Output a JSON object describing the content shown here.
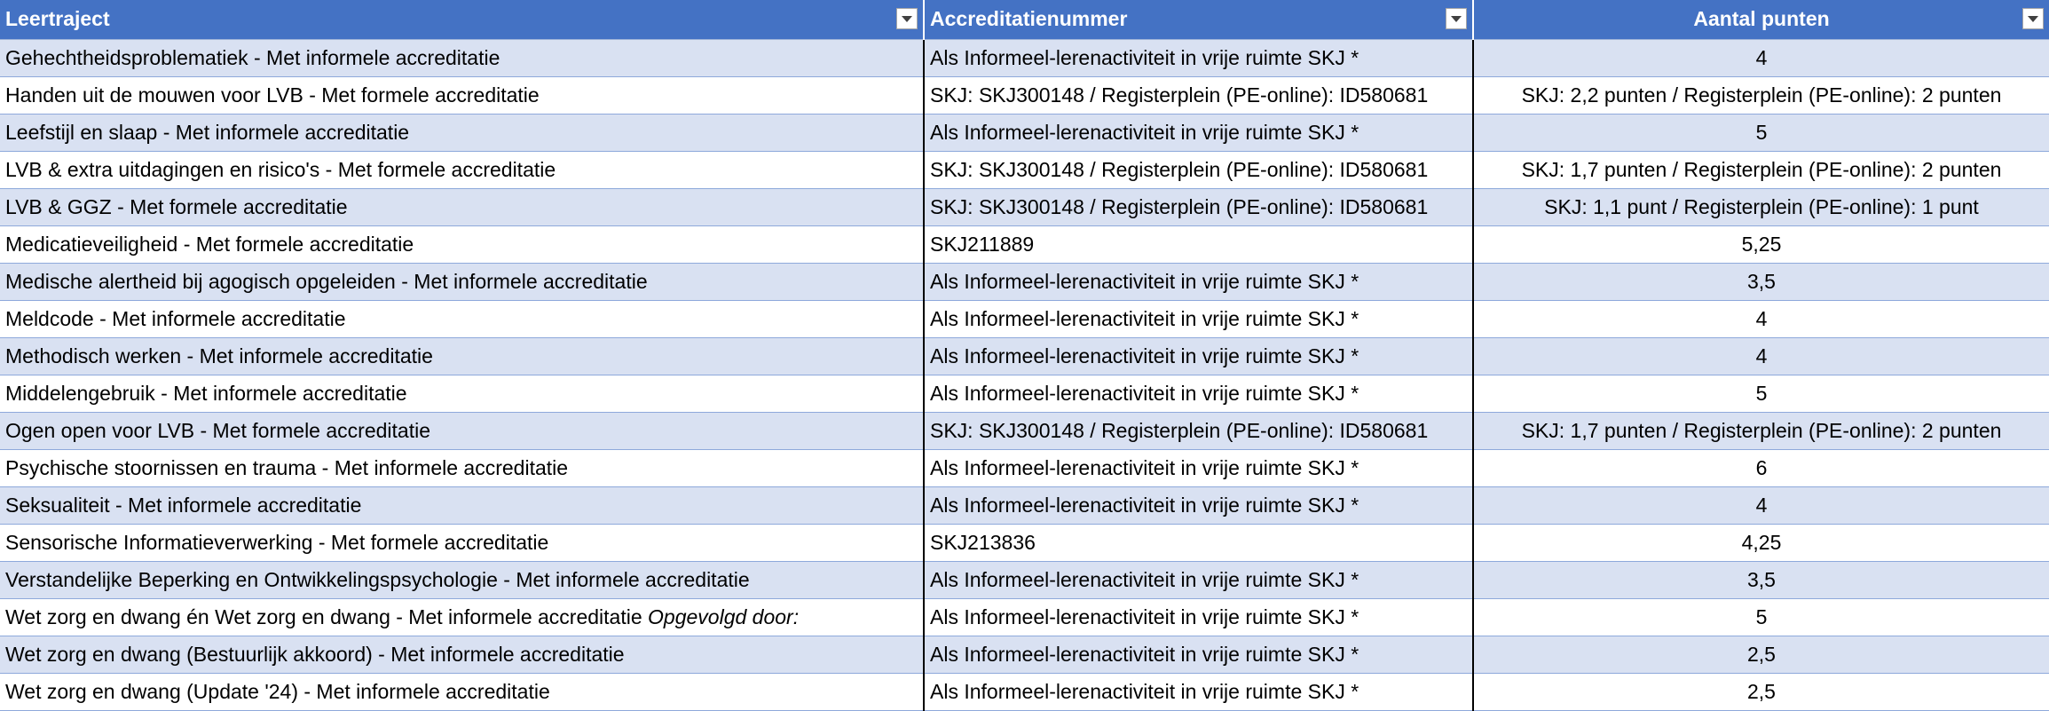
{
  "table": {
    "headers": [
      "Leertraject",
      "Accreditatienummer",
      "Aantal punten"
    ],
    "rows": [
      {
        "leertraject": "Gehechtheidsproblematiek - Met informele accreditatie",
        "accreditatienummer": "Als Informeel-lerenactiviteit in vrije ruimte SKJ *",
        "punten": "4"
      },
      {
        "leertraject": "Handen uit de mouwen voor LVB - Met formele accreditatie",
        "accreditatienummer": "SKJ: SKJ300148 / Registerplein (PE-online): ID580681",
        "punten": "SKJ: 2,2 punten / Registerplein (PE-online): 2 punten"
      },
      {
        "leertraject": "Leefstijl en slaap - Met informele accreditatie",
        "accreditatienummer": "Als Informeel-lerenactiviteit in vrije ruimte SKJ *",
        "punten": "5"
      },
      {
        "leertraject": "LVB & extra uitdagingen en risico's - Met formele accreditatie",
        "accreditatienummer": "SKJ: SKJ300148 / Registerplein (PE-online): ID580681",
        "punten": "SKJ: 1,7 punten / Registerplein (PE-online): 2 punten"
      },
      {
        "leertraject": "LVB & GGZ - Met formele accreditatie",
        "accreditatienummer": "SKJ: SKJ300148 / Registerplein (PE-online): ID580681",
        "punten": "SKJ: 1,1 punt / Registerplein (PE-online): 1 punt"
      },
      {
        "leertraject": "Medicatieveiligheid - Met formele accreditatie",
        "accreditatienummer": "SKJ211889",
        "punten": "5,25"
      },
      {
        "leertraject": "Medische alertheid bij agogisch opgeleiden - Met informele accreditatie",
        "accreditatienummer": "Als Informeel-lerenactiviteit in vrije ruimte SKJ *",
        "punten": "3,5"
      },
      {
        "leertraject": "Meldcode - Met informele accreditatie",
        "accreditatienummer": "Als Informeel-lerenactiviteit in vrije ruimte SKJ *",
        "punten": "4"
      },
      {
        "leertraject": "Methodisch werken - Met informele accreditatie",
        "accreditatienummer": "Als Informeel-lerenactiviteit in vrije ruimte SKJ *",
        "punten": "4"
      },
      {
        "leertraject": "Middelengebruik - Met informele accreditatie",
        "accreditatienummer": "Als Informeel-lerenactiviteit in vrije ruimte SKJ *",
        "punten": "5"
      },
      {
        "leertraject": "Ogen open voor LVB - Met formele accreditatie",
        "accreditatienummer": "SKJ: SKJ300148 / Registerplein (PE-online): ID580681",
        "punten": "SKJ: 1,7 punten / Registerplein (PE-online): 2 punten"
      },
      {
        "leertraject": "Psychische stoornissen en trauma - Met informele accreditatie",
        "accreditatienummer": "Als Informeel-lerenactiviteit in vrije ruimte SKJ *",
        "punten": "6"
      },
      {
        "leertraject": "Seksualiteit - Met informele accreditatie",
        "accreditatienummer": "Als Informeel-lerenactiviteit in vrije ruimte SKJ *",
        "punten": "4"
      },
      {
        "leertraject": "Sensorische Informatieverwerking - Met formele accreditatie",
        "accreditatienummer": "SKJ213836",
        "punten": "4,25"
      },
      {
        "leertraject": "Verstandelijke Beperking en Ontwikkelingspsychologie - Met informele accreditatie",
        "accreditatienummer": "Als Informeel-lerenactiviteit in vrije ruimte SKJ *",
        "punten": "3,5"
      },
      {
        "leertraject": "Wet zorg en dwang én Wet zorg en dwang - Met informele accreditatie",
        "leertraject_suffix": "Opgevolgd door:",
        "accreditatienummer": "Als Informeel-lerenactiviteit in vrije ruimte SKJ *",
        "punten": "5"
      },
      {
        "leertraject": "Wet zorg en dwang (Bestuurlijk akkoord) - Met informele accreditatie",
        "accreditatienummer": "Als Informeel-lerenactiviteit in vrije ruimte SKJ *",
        "punten": "2,5"
      },
      {
        "leertraject": "Wet zorg en dwang (Update '24) - Met informele accreditatie",
        "accreditatienummer": "Als Informeel-lerenactiviteit in vrije ruimte SKJ *",
        "punten": "2,5"
      }
    ]
  },
  "colors": {
    "header_bg": "#4472c4",
    "header_text": "#ffffff",
    "band_bg": "#d9e1f2",
    "plain_bg": "#ffffff"
  },
  "icons": {
    "filter": "dropdown-arrow"
  }
}
